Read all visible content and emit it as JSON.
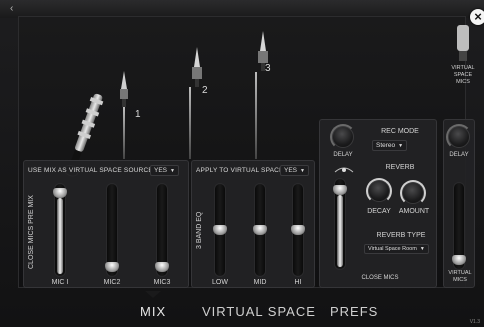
{
  "panel": {
    "close_label": "×",
    "mics": [
      "1",
      "2",
      "3"
    ],
    "virtual_space_mics_label": "VIRTUAL SPACE MICS"
  },
  "mix_section": {
    "header": "USE MIX AS VIRTUAL SPACE SOURCE",
    "select_value": "YES",
    "vertical_label": "CLOSE MICS PRE MIX",
    "faders": [
      {
        "label": "MIC I",
        "level": 0.95
      },
      {
        "label": "MIC2",
        "level": 0.05
      },
      {
        "label": "MIC3",
        "level": 0.05
      }
    ]
  },
  "eq_section": {
    "header": "APPLY TO VIRTUAL SPACE",
    "select_value": "YES",
    "vertical_label": "3 BAND EQ",
    "bands": [
      {
        "label": "LOW",
        "level": 0.5
      },
      {
        "label": "MID",
        "level": 0.5
      },
      {
        "label": "HI",
        "level": 0.5
      }
    ]
  },
  "close_mics_section": {
    "delay_label": "DELAY",
    "rec_mode_label": "REC MODE",
    "rec_mode_value": "Stereo",
    "reverb_label": "REVERB",
    "decay_label": "DECAY",
    "amount_label": "AMOUNT",
    "reverb_type_label": "REVERB TYPE",
    "reverb_type_value": "Virtual Space Room",
    "footer_label": "CLOSE MICS",
    "fader_level": 0.92
  },
  "virtual_mics_section": {
    "delay_label": "DELAY",
    "footer_label": "VIRTUAL MICS",
    "fader_level": 0.05
  },
  "tabs": [
    {
      "label": "MIX",
      "active": true
    },
    {
      "label": "VIRTUAL SPACE",
      "active": false
    },
    {
      "label": "PREFS",
      "active": false
    }
  ],
  "version": "V1.3"
}
